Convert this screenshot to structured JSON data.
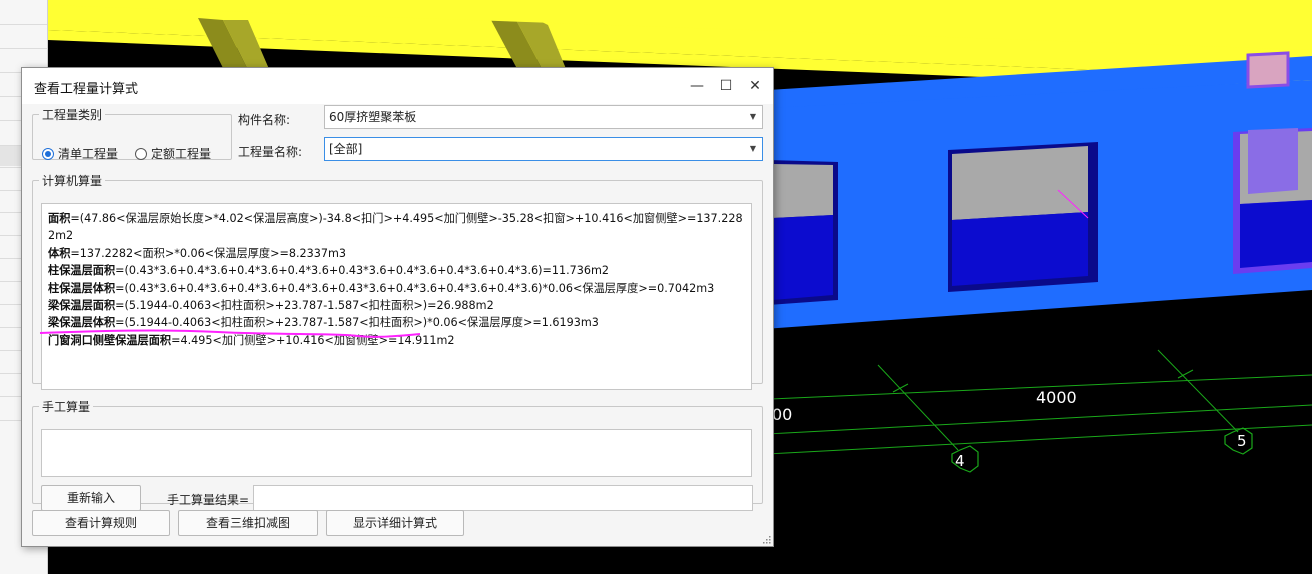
{
  "dialog": {
    "title": "查看工程量计算式",
    "qty_type_group": "工程量类别",
    "radio_list": "清单工程量",
    "radio_quota": "定额工程量",
    "component_name_label": "构件名称:",
    "component_name_value": "60厚挤塑聚苯板",
    "qty_name_label": "工程量名称:",
    "qty_name_value": "[全部]",
    "calc_group": "计算机算量",
    "calc_lines": [
      {
        "name": "面积",
        "formula": "=(47.86<保温层原始长度>*4.02<保温层高度>)-34.8<扣门>+4.495<加门侧壁>-35.28<扣窗>+10.416<加窗侧壁>=137.2282m2"
      },
      {
        "name": "体积",
        "formula": "=137.2282<面积>*0.06<保温层厚度>=8.2337m3"
      },
      {
        "name": "柱保温层面积",
        "formula": "=(0.43*3.6+0.4*3.6+0.4*3.6+0.4*3.6+0.43*3.6+0.4*3.6+0.4*3.6+0.4*3.6)=11.736m2"
      },
      {
        "name": "柱保温层体积",
        "formula": "=(0.43*3.6+0.4*3.6+0.4*3.6+0.4*3.6+0.43*3.6+0.4*3.6+0.4*3.6+0.4*3.6)*0.06<保温层厚度>=0.7042m3"
      },
      {
        "name": "梁保温层面积",
        "formula": "=(5.1944-0.4063<扣柱面积>+23.787-1.587<扣柱面积>)=26.988m2"
      },
      {
        "name": "梁保温层体积",
        "formula": "=(5.1944-0.4063<扣柱面积>+23.787-1.587<扣柱面积>)*0.06<保温层厚度>=1.6193m3"
      },
      {
        "name": "门窗洞口侧壁保温层面积",
        "formula": "=4.495<加门侧壁>+10.416<加窗侧壁>=14.911m2"
      }
    ],
    "manual_group": "手工算量",
    "reinput_button": "重新输入",
    "manual_result_label": "手工算量结果=",
    "rules_button": "查看计算规则",
    "view3d_button": "查看三维扣减图",
    "detail_button": "显示详细计算式"
  },
  "viewport": {
    "dim_label_partial": "00",
    "dim_label": "4000",
    "axis_4": "4",
    "axis_5": "5"
  },
  "colors": {
    "slab": "#ffff33",
    "wall": "#1f6dff",
    "window_glass": "#a9a9a9",
    "window_frame": "#0a0a8a",
    "annotation": "#ff22ff",
    "grid_line": "#1aa81a"
  }
}
